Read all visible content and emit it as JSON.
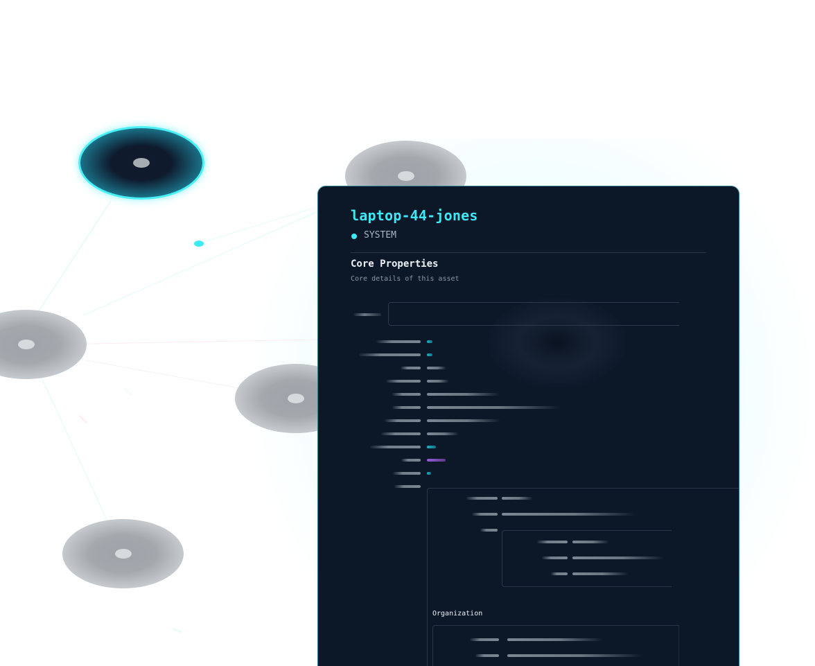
{
  "graph": {
    "nodes": [
      {
        "name": "node-active",
        "state": "selected"
      },
      {
        "name": "node-1",
        "state": "default"
      },
      {
        "name": "node-2",
        "state": "default"
      },
      {
        "name": "node-3",
        "state": "default"
      },
      {
        "name": "node-4",
        "state": "default"
      }
    ],
    "colors": {
      "accent": "#3ce9f5",
      "node_fill": "#a4a8ad",
      "panel_bg": "#0c1728"
    }
  },
  "panel": {
    "title": "laptop-44-jones",
    "type_label": "SYSTEM",
    "type_icon": "status-dot-icon",
    "section": {
      "title": "Core Properties",
      "subtitle": "Core details of this asset"
    },
    "organization_title": "Organization"
  }
}
